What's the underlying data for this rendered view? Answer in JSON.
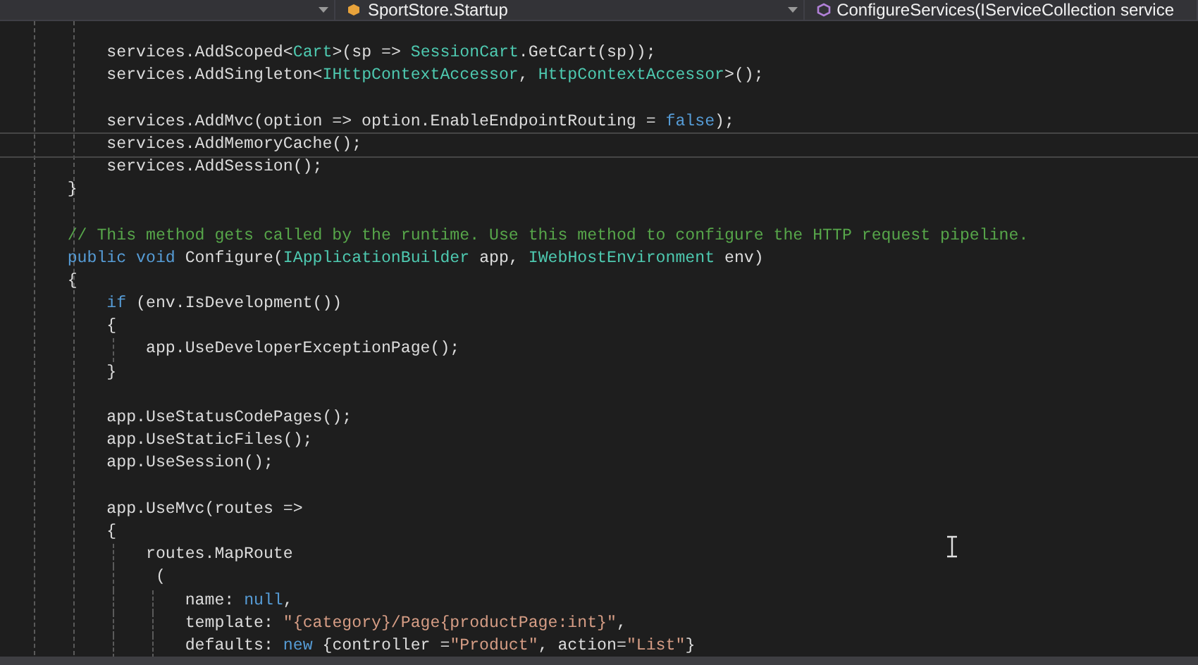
{
  "navbar": {
    "dropdowns": [
      {
        "kind": "blank"
      },
      {
        "kind": "type",
        "label": "SportStore.Startup"
      },
      {
        "kind": "member",
        "label": "ConfigureServices(IServiceCollection service"
      }
    ]
  },
  "editor": {
    "lines": [
      {
        "tokens": [
          {
            "text": "        services.AddScoped<",
            "kind": "plain"
          },
          {
            "text": "Cart",
            "kind": "type"
          },
          {
            "text": ">(sp => ",
            "kind": "plain"
          },
          {
            "text": "SessionCart",
            "kind": "type"
          },
          {
            "text": ".GetCart(sp));",
            "kind": "plain"
          }
        ]
      },
      {
        "tokens": [
          {
            "text": "        services.AddSingleton<",
            "kind": "plain"
          },
          {
            "text": "IHttpContextAccessor",
            "kind": "type"
          },
          {
            "text": ", ",
            "kind": "plain"
          },
          {
            "text": "HttpContextAccessor",
            "kind": "type"
          },
          {
            "text": ">();",
            "kind": "plain"
          }
        ]
      },
      {
        "blank_before": true,
        "tokens": [
          {
            "text": "        services.AddMvc(option => option.EnableEndpointRouting = ",
            "kind": "plain"
          },
          {
            "text": "false",
            "kind": "keyword"
          },
          {
            "text": ");",
            "kind": "plain"
          }
        ]
      },
      {
        "current": true,
        "tokens": [
          {
            "text": "        services.AddMemoryCache();",
            "kind": "plain"
          }
        ]
      },
      {
        "tokens": [
          {
            "text": "        services.AddSession();",
            "kind": "plain"
          }
        ]
      },
      {
        "tokens": [
          {
            "text": "    }",
            "kind": "plain"
          }
        ]
      },
      {
        "blank_before": true,
        "tokens": [
          {
            "text": "    // This method gets called by the runtime. Use this method to configure the HTTP request pipeline.",
            "kind": "comment"
          }
        ]
      },
      {
        "tokens": [
          {
            "text": "    public",
            "kind": "keyword"
          },
          {
            "text": " void",
            "kind": "keyword"
          },
          {
            "text": " Configure(",
            "kind": "plain"
          },
          {
            "text": "IApplicationBuilder",
            "kind": "type"
          },
          {
            "text": " app, ",
            "kind": "plain"
          },
          {
            "text": "IWebHostEnvironment",
            "kind": "type"
          },
          {
            "text": " env)",
            "kind": "plain"
          }
        ]
      },
      {
        "tokens": [
          {
            "text": "    {",
            "kind": "plain"
          }
        ]
      },
      {
        "tokens": [
          {
            "text": "        if",
            "kind": "keyword"
          },
          {
            "text": " (env.IsDevelopment())",
            "kind": "plain"
          }
        ]
      },
      {
        "tokens": [
          {
            "text": "        {",
            "kind": "plain"
          }
        ]
      },
      {
        "tokens": [
          {
            "text": "            app.UseDeveloperExceptionPage();",
            "kind": "plain"
          }
        ]
      },
      {
        "tokens": [
          {
            "text": "        }",
            "kind": "plain"
          }
        ]
      },
      {
        "blank_before": true,
        "tokens": [
          {
            "text": "        app.UseStatusCodePages();",
            "kind": "plain"
          }
        ]
      },
      {
        "tokens": [
          {
            "text": "        app.UseStaticFiles();",
            "kind": "plain"
          }
        ]
      },
      {
        "tokens": [
          {
            "text": "        app.UseSession();",
            "kind": "plain"
          }
        ]
      },
      {
        "blank_before": true,
        "tokens": [
          {
            "text": "        app.UseMvc(routes =>",
            "kind": "plain"
          }
        ]
      },
      {
        "tokens": [
          {
            "text": "        {",
            "kind": "plain"
          }
        ]
      },
      {
        "tokens": [
          {
            "text": "            routes.MapRoute",
            "kind": "plain"
          }
        ]
      },
      {
        "tokens": [
          {
            "text": "             (",
            "kind": "plain"
          }
        ]
      },
      {
        "tokens": [
          {
            "text": "                name: ",
            "kind": "plain"
          },
          {
            "text": "null",
            "kind": "keyword"
          },
          {
            "text": ",",
            "kind": "plain"
          }
        ]
      },
      {
        "tokens": [
          {
            "text": "                template: ",
            "kind": "plain"
          },
          {
            "text": "\"{category}/Page{productPage:int}\"",
            "kind": "string"
          },
          {
            "text": ",",
            "kind": "plain"
          }
        ]
      },
      {
        "tokens": [
          {
            "text": "                defaults: ",
            "kind": "plain"
          },
          {
            "text": "new",
            "kind": "keyword"
          },
          {
            "text": " {controller =",
            "kind": "plain"
          },
          {
            "text": "\"Product\"",
            "kind": "string"
          },
          {
            "text": ", action=",
            "kind": "plain"
          },
          {
            "text": "\"List\"",
            "kind": "string"
          },
          {
            "text": "}",
            "kind": "plain"
          }
        ]
      }
    ]
  }
}
